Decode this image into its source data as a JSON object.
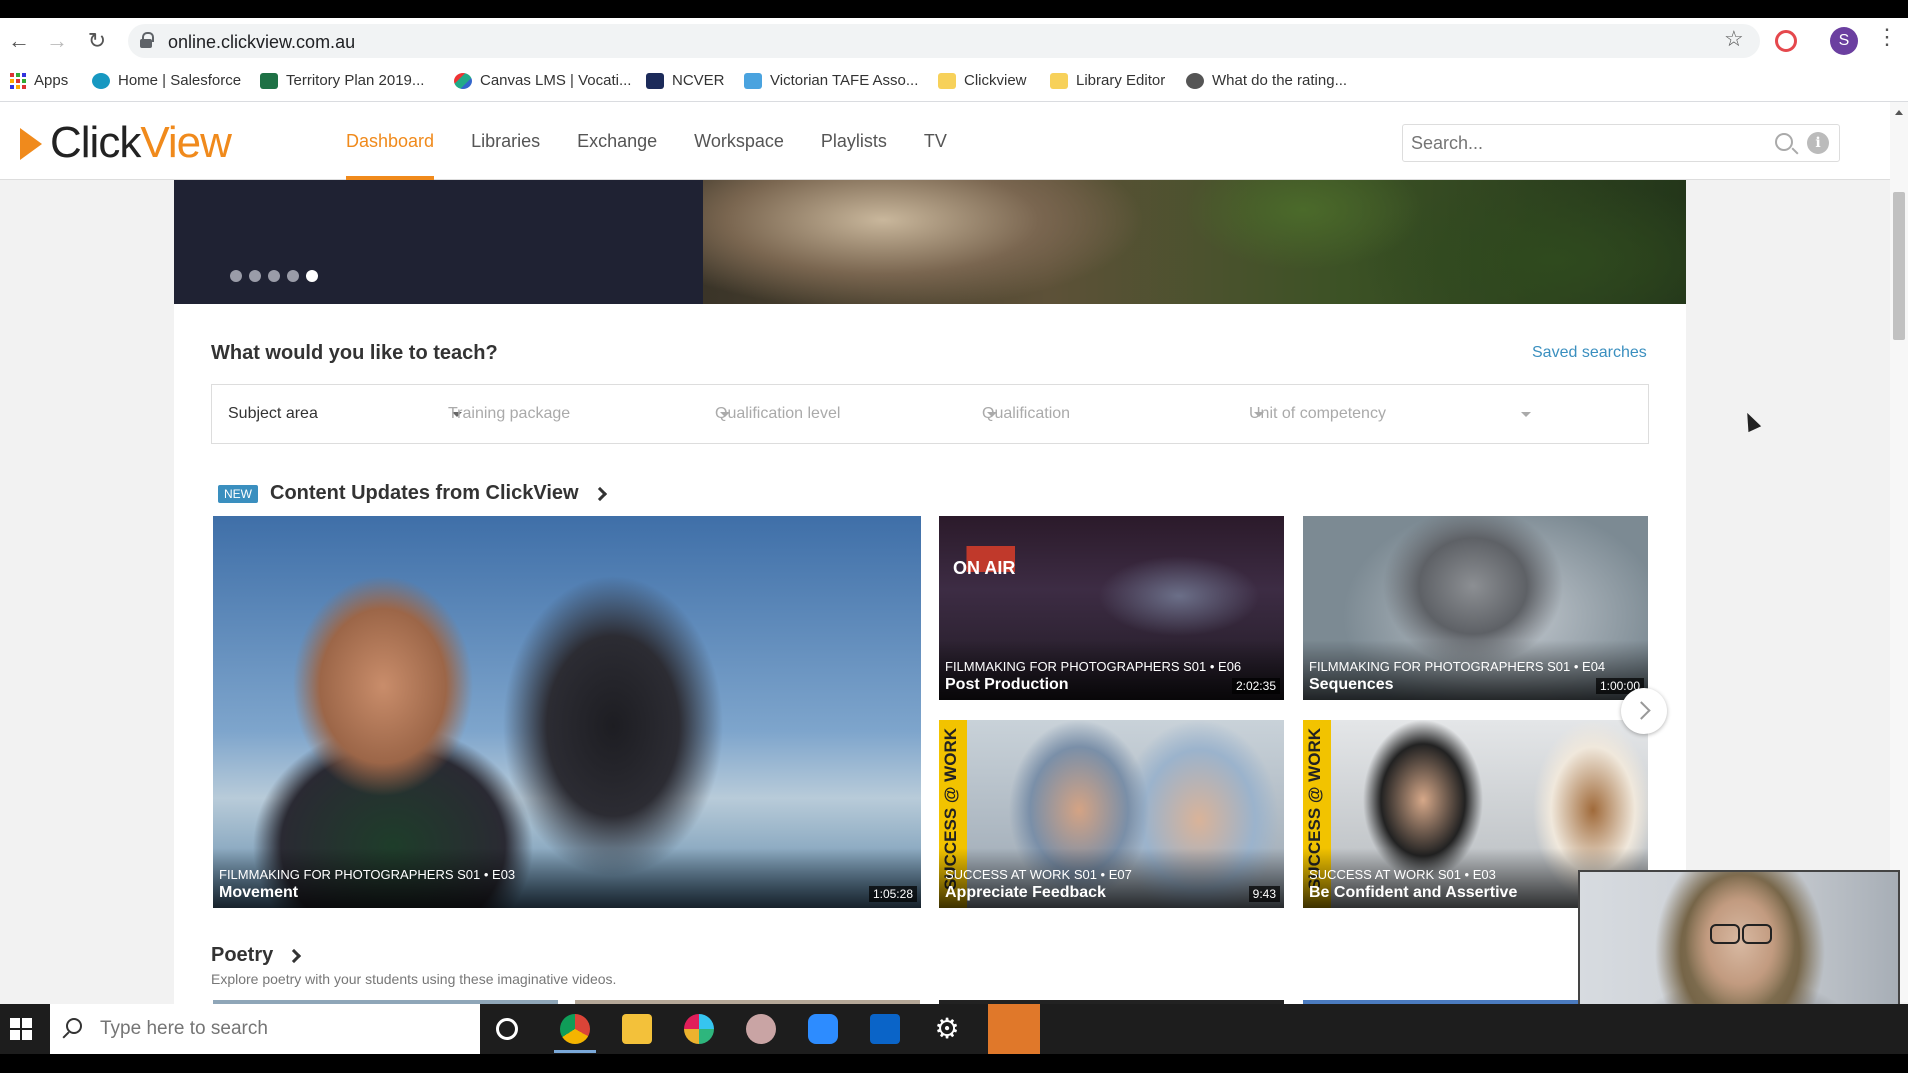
{
  "browser": {
    "url": "online.clickview.com.au",
    "profile_initial": "S",
    "bookmarks": [
      {
        "label": "Apps"
      },
      {
        "label": "Home | Salesforce"
      },
      {
        "label": "Territory Plan 2019..."
      },
      {
        "label": "Canvas LMS | Vocati..."
      },
      {
        "label": "NCVER"
      },
      {
        "label": "Victorian TAFE Asso..."
      },
      {
        "label": "Clickview"
      },
      {
        "label": "Library Editor"
      },
      {
        "label": "What do the rating..."
      }
    ]
  },
  "header": {
    "logo_click": "Click",
    "logo_view": "View",
    "nav": [
      {
        "label": "Dashboard",
        "active": true
      },
      {
        "label": "Libraries"
      },
      {
        "label": "Exchange"
      },
      {
        "label": "Workspace"
      },
      {
        "label": "Playlists"
      },
      {
        "label": "TV"
      }
    ],
    "search_placeholder": "Search...",
    "info_glyph": "i",
    "accent_color": "#f08a1c"
  },
  "banner": {
    "slides_total": 5,
    "active_slide": 5
  },
  "teach": {
    "title": "What would you like to teach?",
    "saved_searches": "Saved searches",
    "filters": [
      {
        "label": "Subject area",
        "enabled": true
      },
      {
        "label": "Training package",
        "enabled": false
      },
      {
        "label": "Qualification level",
        "enabled": false
      },
      {
        "label": "Qualification",
        "enabled": false
      },
      {
        "label": "Unit of competency",
        "enabled": false
      }
    ]
  },
  "content_updates": {
    "badge": "NEW",
    "title": "Content Updates from ClickView",
    "videos": [
      {
        "series": "FILMMAKING FOR PHOTOGRAPHERS   S01 • E03",
        "title": "Movement",
        "duration": "1:05:28"
      },
      {
        "series": "FILMMAKING FOR PHOTOGRAPHERS   S01 • E06",
        "title": "Post Production",
        "duration": "2:02:35",
        "sign": "ON AIR"
      },
      {
        "series": "FILMMAKING FOR PHOTOGRAPHERS   S01 • E04",
        "title": "Sequences",
        "duration": "1:00:00"
      },
      {
        "series": "SUCCESS AT WORK   S01 • E07",
        "title": "Appreciate Feedback",
        "duration": "9:43",
        "vertical": "SUCCESS @ WORK"
      },
      {
        "series": "SUCCESS AT WORK   S01 • E03",
        "title": "Be Confident and Assertive",
        "duration": "",
        "vertical": "SUCCESS @ WORK"
      }
    ]
  },
  "poetry": {
    "title": "Poetry",
    "subtitle": "Explore poetry with your students using these imaginative videos."
  },
  "taskbar": {
    "search_placeholder": "Type here to search"
  }
}
